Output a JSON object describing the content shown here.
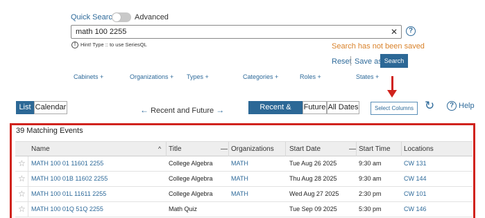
{
  "search": {
    "quick_label": "Quick Search",
    "advanced_label": "Advanced",
    "query": "math 100 2255",
    "hint": "Hint! Type :: to use SeriesQL",
    "status": "Search has not been saved",
    "reset_label": "Reset",
    "saveas_label": "Save as",
    "search_button": "Search"
  },
  "filters": [
    "Cabinets +",
    "Organizations +",
    "Types +",
    "Categories +",
    "Roles +",
    "States +"
  ],
  "view": {
    "list_label": "List",
    "calendar_label": "Calendar",
    "recent_future": "Recent and Future",
    "time_tabs": [
      "Recent & Future",
      "Future",
      "All Dates"
    ],
    "select_columns": "Select Columns",
    "help_label": "Help"
  },
  "results": {
    "count_label": "39 Matching Events",
    "columns": [
      "Name",
      "Title",
      "Organizations",
      "Start Date",
      "Start Time",
      "Locations"
    ],
    "rows": [
      {
        "name": "MATH 100 01 11601 2255",
        "title": "College Algebra",
        "org": "MATH",
        "date": "Tue Aug 26 2025",
        "time": "9:30 am",
        "location": "CW 131"
      },
      {
        "name": "MATH 100 01B 11602 2255",
        "title": "College Algebra",
        "org": "MATH",
        "date": "Thu Aug 28 2025",
        "time": "9:30 am",
        "location": "CW 144"
      },
      {
        "name": "MATH 100 01L 11611 2255",
        "title": "College Algebra",
        "org": "MATH",
        "date": "Wed Aug 27 2025",
        "time": "2:30 pm",
        "location": "CW 101"
      },
      {
        "name": "MATH 100 01Q 51Q 2255",
        "title": "Math Quiz",
        "org": "",
        "date": "Tue Sep 09 2025",
        "time": "5:30 pm",
        "location": "CW 146"
      }
    ]
  },
  "colors": {
    "accent": "#2c6896",
    "link": "#2e6a9a",
    "warning": "#d9822b",
    "highlight": "#d0231d"
  }
}
